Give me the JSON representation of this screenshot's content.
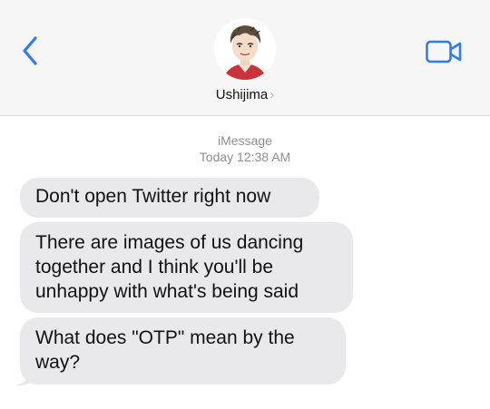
{
  "header": {
    "contact_name": "Ushijima",
    "chevron": "›",
    "back_icon": "chevron-left-icon",
    "video_icon": "video-camera-icon",
    "accent_color": "#2f7cf6"
  },
  "conversation": {
    "service": "iMessage",
    "timestamp": "Today 12:38 AM",
    "messages": [
      {
        "text": "Don't open Twitter right now"
      },
      {
        "text": "There are images of us dancing together and I think you'll be unhappy with what's being said"
      },
      {
        "text": "What does \"OTP\" mean by the way?"
      }
    ]
  }
}
